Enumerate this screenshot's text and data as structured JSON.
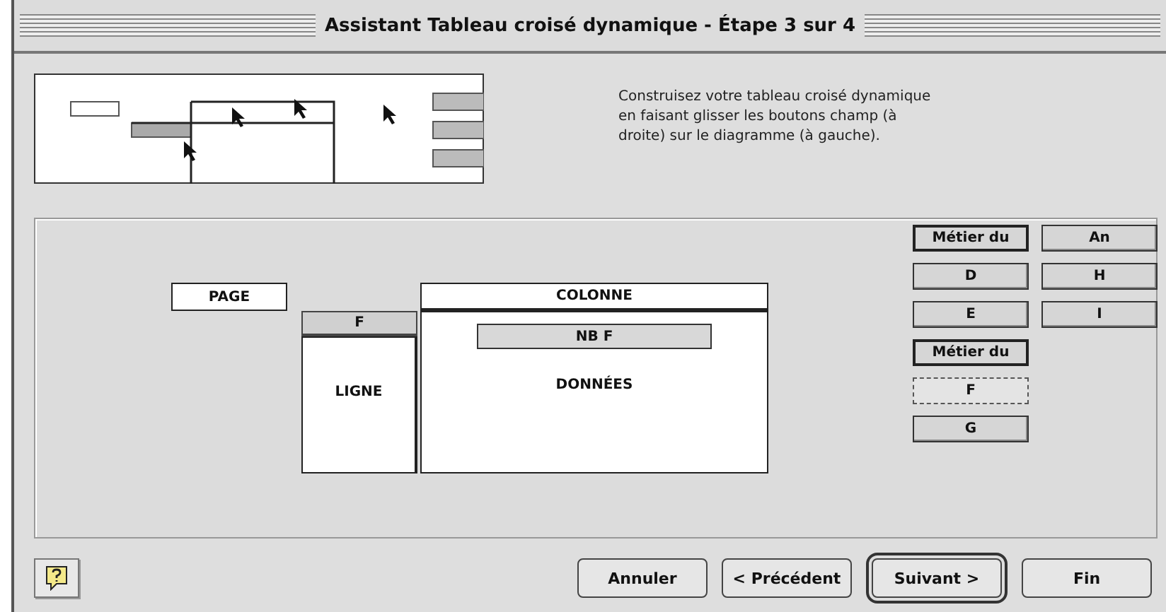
{
  "window": {
    "title": "Assistant Tableau croisé dynamique - Étape 3 sur 4"
  },
  "instructions": "Construisez votre tableau croisé dynamique\nen faisant glisser les boutons champ (à\ndroite) sur le diagramme (à gauche).",
  "layout": {
    "page_label": "PAGE",
    "column_label": "COLONNE",
    "row_label": "LIGNE",
    "data_label": "DONNÉES",
    "row_fields": [
      "F"
    ],
    "data_fields": [
      "NB F"
    ]
  },
  "field_columns": [
    {
      "fields": [
        {
          "label": "Métier du",
          "kind": "bold"
        },
        {
          "label": "D",
          "kind": "plain"
        },
        {
          "label": "E",
          "kind": "plain"
        },
        {
          "label": "Métier du",
          "kind": "bold"
        },
        {
          "label": "F",
          "kind": "placed"
        },
        {
          "label": "G",
          "kind": "plain"
        }
      ]
    },
    {
      "fields": [
        {
          "label": "An",
          "kind": "plain"
        },
        {
          "label": "H",
          "kind": "plain"
        },
        {
          "label": "I",
          "kind": "plain"
        }
      ]
    }
  ],
  "buttons": [
    {
      "label": "Annuler",
      "default": false
    },
    {
      "label": "< Précédent",
      "default": false
    },
    {
      "label": "Suivant >",
      "default": true
    },
    {
      "label": "Fin",
      "default": false
    }
  ]
}
